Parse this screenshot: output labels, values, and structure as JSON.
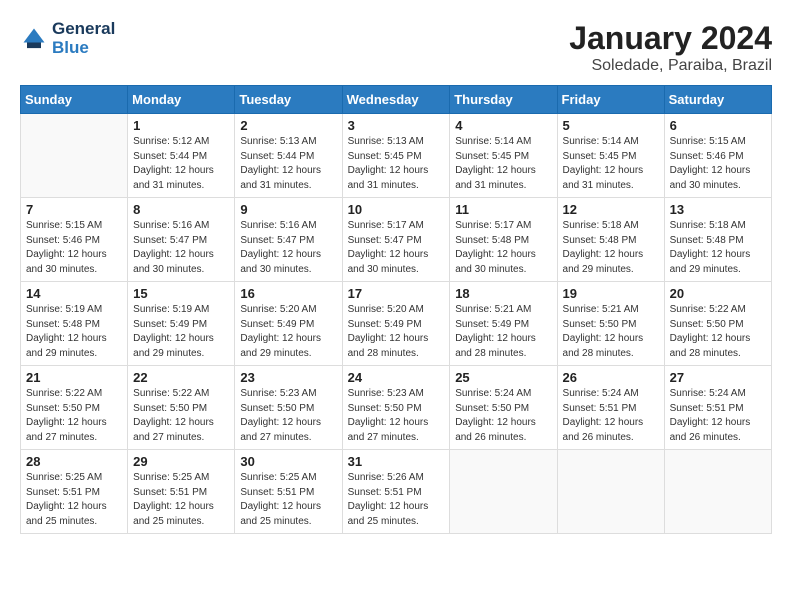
{
  "header": {
    "logo_line1": "General",
    "logo_line2": "Blue",
    "month_year": "January 2024",
    "location": "Soledade, Paraiba, Brazil"
  },
  "weekdays": [
    "Sunday",
    "Monday",
    "Tuesday",
    "Wednesday",
    "Thursday",
    "Friday",
    "Saturday"
  ],
  "weeks": [
    [
      {
        "day": "",
        "info": ""
      },
      {
        "day": "1",
        "info": "Sunrise: 5:12 AM\nSunset: 5:44 PM\nDaylight: 12 hours\nand 31 minutes."
      },
      {
        "day": "2",
        "info": "Sunrise: 5:13 AM\nSunset: 5:44 PM\nDaylight: 12 hours\nand 31 minutes."
      },
      {
        "day": "3",
        "info": "Sunrise: 5:13 AM\nSunset: 5:45 PM\nDaylight: 12 hours\nand 31 minutes."
      },
      {
        "day": "4",
        "info": "Sunrise: 5:14 AM\nSunset: 5:45 PM\nDaylight: 12 hours\nand 31 minutes."
      },
      {
        "day": "5",
        "info": "Sunrise: 5:14 AM\nSunset: 5:45 PM\nDaylight: 12 hours\nand 31 minutes."
      },
      {
        "day": "6",
        "info": "Sunrise: 5:15 AM\nSunset: 5:46 PM\nDaylight: 12 hours\nand 30 minutes."
      }
    ],
    [
      {
        "day": "7",
        "info": "Sunrise: 5:15 AM\nSunset: 5:46 PM\nDaylight: 12 hours\nand 30 minutes."
      },
      {
        "day": "8",
        "info": "Sunrise: 5:16 AM\nSunset: 5:47 PM\nDaylight: 12 hours\nand 30 minutes."
      },
      {
        "day": "9",
        "info": "Sunrise: 5:16 AM\nSunset: 5:47 PM\nDaylight: 12 hours\nand 30 minutes."
      },
      {
        "day": "10",
        "info": "Sunrise: 5:17 AM\nSunset: 5:47 PM\nDaylight: 12 hours\nand 30 minutes."
      },
      {
        "day": "11",
        "info": "Sunrise: 5:17 AM\nSunset: 5:48 PM\nDaylight: 12 hours\nand 30 minutes."
      },
      {
        "day": "12",
        "info": "Sunrise: 5:18 AM\nSunset: 5:48 PM\nDaylight: 12 hours\nand 29 minutes."
      },
      {
        "day": "13",
        "info": "Sunrise: 5:18 AM\nSunset: 5:48 PM\nDaylight: 12 hours\nand 29 minutes."
      }
    ],
    [
      {
        "day": "14",
        "info": "Sunrise: 5:19 AM\nSunset: 5:48 PM\nDaylight: 12 hours\nand 29 minutes."
      },
      {
        "day": "15",
        "info": "Sunrise: 5:19 AM\nSunset: 5:49 PM\nDaylight: 12 hours\nand 29 minutes."
      },
      {
        "day": "16",
        "info": "Sunrise: 5:20 AM\nSunset: 5:49 PM\nDaylight: 12 hours\nand 29 minutes."
      },
      {
        "day": "17",
        "info": "Sunrise: 5:20 AM\nSunset: 5:49 PM\nDaylight: 12 hours\nand 28 minutes."
      },
      {
        "day": "18",
        "info": "Sunrise: 5:21 AM\nSunset: 5:49 PM\nDaylight: 12 hours\nand 28 minutes."
      },
      {
        "day": "19",
        "info": "Sunrise: 5:21 AM\nSunset: 5:50 PM\nDaylight: 12 hours\nand 28 minutes."
      },
      {
        "day": "20",
        "info": "Sunrise: 5:22 AM\nSunset: 5:50 PM\nDaylight: 12 hours\nand 28 minutes."
      }
    ],
    [
      {
        "day": "21",
        "info": "Sunrise: 5:22 AM\nSunset: 5:50 PM\nDaylight: 12 hours\nand 27 minutes."
      },
      {
        "day": "22",
        "info": "Sunrise: 5:22 AM\nSunset: 5:50 PM\nDaylight: 12 hours\nand 27 minutes."
      },
      {
        "day": "23",
        "info": "Sunrise: 5:23 AM\nSunset: 5:50 PM\nDaylight: 12 hours\nand 27 minutes."
      },
      {
        "day": "24",
        "info": "Sunrise: 5:23 AM\nSunset: 5:50 PM\nDaylight: 12 hours\nand 27 minutes."
      },
      {
        "day": "25",
        "info": "Sunrise: 5:24 AM\nSunset: 5:50 PM\nDaylight: 12 hours\nand 26 minutes."
      },
      {
        "day": "26",
        "info": "Sunrise: 5:24 AM\nSunset: 5:51 PM\nDaylight: 12 hours\nand 26 minutes."
      },
      {
        "day": "27",
        "info": "Sunrise: 5:24 AM\nSunset: 5:51 PM\nDaylight: 12 hours\nand 26 minutes."
      }
    ],
    [
      {
        "day": "28",
        "info": "Sunrise: 5:25 AM\nSunset: 5:51 PM\nDaylight: 12 hours\nand 25 minutes."
      },
      {
        "day": "29",
        "info": "Sunrise: 5:25 AM\nSunset: 5:51 PM\nDaylight: 12 hours\nand 25 minutes."
      },
      {
        "day": "30",
        "info": "Sunrise: 5:25 AM\nSunset: 5:51 PM\nDaylight: 12 hours\nand 25 minutes."
      },
      {
        "day": "31",
        "info": "Sunrise: 5:26 AM\nSunset: 5:51 PM\nDaylight: 12 hours\nand 25 minutes."
      },
      {
        "day": "",
        "info": ""
      },
      {
        "day": "",
        "info": ""
      },
      {
        "day": "",
        "info": ""
      }
    ]
  ]
}
